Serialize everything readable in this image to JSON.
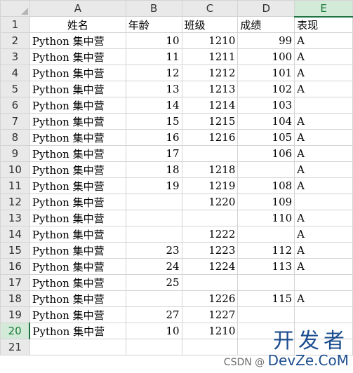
{
  "columns": [
    "A",
    "B",
    "C",
    "D",
    "E"
  ],
  "selected_column": "E",
  "selected_row": "20",
  "rows": [
    {
      "n": "1",
      "a": "姓名",
      "b": "年龄",
      "c": "班级",
      "d": "成绩",
      "e": "表现"
    },
    {
      "n": "2",
      "a": "Python 集中营",
      "b": "10",
      "c": "1210",
      "d": "99",
      "e": "A"
    },
    {
      "n": "3",
      "a": "Python 集中营",
      "b": "11",
      "c": "1211",
      "d": "100",
      "e": "A"
    },
    {
      "n": "4",
      "a": "Python 集中营",
      "b": "12",
      "c": "1212",
      "d": "101",
      "e": "A"
    },
    {
      "n": "5",
      "a": "Python 集中营",
      "b": "13",
      "c": "1213",
      "d": "102",
      "e": "A"
    },
    {
      "n": "6",
      "a": "Python 集中营",
      "b": "14",
      "c": "1214",
      "d": "103",
      "e": ""
    },
    {
      "n": "7",
      "a": "Python 集中营",
      "b": "15",
      "c": "1215",
      "d": "104",
      "e": "A"
    },
    {
      "n": "8",
      "a": "Python 集中营",
      "b": "16",
      "c": "1216",
      "d": "105",
      "e": "A"
    },
    {
      "n": "9",
      "a": "Python 集中营",
      "b": "17",
      "c": "",
      "d": "106",
      "e": "A"
    },
    {
      "n": "10",
      "a": "Python 集中营",
      "b": "18",
      "c": "1218",
      "d": "",
      "e": "A"
    },
    {
      "n": "11",
      "a": "Python 集中营",
      "b": "19",
      "c": "1219",
      "d": "108",
      "e": "A"
    },
    {
      "n": "12",
      "a": "Python 集中营",
      "b": "",
      "c": "1220",
      "d": "109",
      "e": ""
    },
    {
      "n": "13",
      "a": "Python 集中营",
      "b": "",
      "c": "",
      "d": "110",
      "e": "A"
    },
    {
      "n": "14",
      "a": "Python 集中营",
      "b": "",
      "c": "1222",
      "d": "",
      "e": "A"
    },
    {
      "n": "15",
      "a": "Python 集中营",
      "b": "23",
      "c": "1223",
      "d": "112",
      "e": "A"
    },
    {
      "n": "16",
      "a": "Python 集中营",
      "b": "24",
      "c": "1224",
      "d": "113",
      "e": "A"
    },
    {
      "n": "17",
      "a": "Python 集中营",
      "b": "25",
      "c": "",
      "d": "",
      "e": ""
    },
    {
      "n": "18",
      "a": "Python 集中营",
      "b": "",
      "c": "1226",
      "d": "115",
      "e": "A"
    },
    {
      "n": "19",
      "a": "Python 集中营",
      "b": "27",
      "c": "1227",
      "d": "",
      "e": ""
    },
    {
      "n": "20",
      "a": "Python 集中营",
      "b": "10",
      "c": "1210",
      "d": "",
      "e": ""
    },
    {
      "n": "21",
      "a": "",
      "b": "",
      "c": "",
      "d": "",
      "e": ""
    }
  ],
  "watermark": {
    "cn": "开发者",
    "csdn": "CSDN @",
    "en": "DevZe.CoM"
  }
}
